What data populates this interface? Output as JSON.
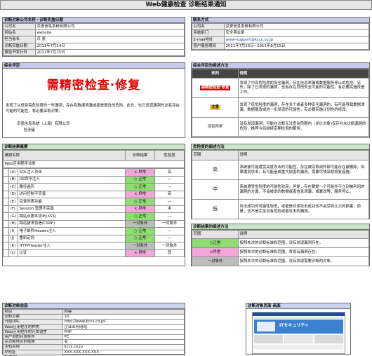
{
  "title": "Web健康检查 诊断结果通知",
  "target_info": {
    "header": "诊断对象公司名称・诊断实施日期",
    "rows": [
      {
        "label": "公司名",
        "value": "京瓷信息系统有限公司"
      },
      {
        "label": "网站名",
        "value": "website"
      },
      {
        "label": "担当者名",
        "value": "京 瓷"
      },
      {
        "label": "诊断实施日期",
        "value": "2011年7月14日"
      },
      {
        "label": "报告书发行日",
        "value": "2011年7月15日"
      }
    ]
  },
  "contact": {
    "header": "联系方式",
    "rows": [
      {
        "label": "公司名",
        "value": "京瓷信息系统有限公司"
      },
      {
        "label": "实施部门",
        "value": "安全事业部"
      },
      {
        "label": "E-mail地址",
        "value": "www-support@kccs.co.jp"
      },
      {
        "label": "客户服务期间",
        "value": "2011年7月15日~2011年8月15日"
      }
    ]
  },
  "overall": {
    "header": "综合评定",
    "verdict": "需精密检查·修复",
    "text": "发现了从低到高危险度的一些漏洞，存在有数据泄漏或者是篡改的危险。此外，也已发现漏洞外出有存在可能的可能性，将必要采取对策。",
    "company": "京瓷信息系统（上海）有限公司",
    "person": "检测者"
  },
  "evaluation": {
    "header": "综合评定的阐述方法",
    "col_eval": "评判",
    "col_desc": "说明",
    "rows": [
      {
        "eval": "需精密检查·修复",
        "desc": "发现了中高危险度的安全漏洞，存在信息泄漏或数据服务停止的危险。另外，除了已发现的漏洞，也有存在其他安全可能的可能性，有必要实施改造工作。"
      },
      {
        "eval": "注意",
        "desc": "发现了低危险度的漏洞，存在多个或者多种安全漏洞的，有可能导致数据泄漏、数据篡改或进一步发现的可能性，有必要实施计划性的修改。"
      },
      {
        "eval": "没有异常",
        "desc": "没有发现漏洞。可能在诊断无法查询范围内（评价对象)仅存在未诊断漏洞的危险，推荐今后继续定期检测的服务。"
      }
    ]
  },
  "results": {
    "header": "诊断结果概要",
    "col_item": "漏洞名称",
    "col_result": "诊断结果",
    "col_risk": "危险度",
    "group": "Web应用程序诊断",
    "items": [
      {
        "id": "(A)",
        "name": "SQL注入攻击",
        "result": "× 异常",
        "status": "ng",
        "risk": "高"
      },
      {
        "id": "(B)",
        "name": "OS命令注入",
        "result": "○ 正常",
        "status": "ok",
        "risk": "—"
      },
      {
        "id": "(C)",
        "name": "路径遍历",
        "result": "○ 正常",
        "status": "ok",
        "risk": "—"
      },
      {
        "id": "(D)",
        "name": "访问控制不完善",
        "result": "× 异常",
        "status": "ng",
        "risk": "高"
      },
      {
        "id": "(E)",
        "name": "目录列表功能",
        "result": "○ 正常",
        "status": "ok",
        "risk": "—"
      },
      {
        "id": "(F)",
        "name": "Session 管理不完善",
        "result": "× 异常",
        "status": "ng",
        "risk": "中"
      },
      {
        "id": "(G)",
        "name": "跨站点脚本攻击(XSS)",
        "result": "○ 正常",
        "status": "ok",
        "risk": "—"
      },
      {
        "id": "(H)",
        "name": "跨站请求伪造(CSRF)",
        "result": "一对象外",
        "status": "cond",
        "risk": "一对象外"
      },
      {
        "id": "(I)",
        "name": "电子邮件Header注入",
        "result": "○ 正常",
        "status": "ok",
        "risk": "—"
      },
      {
        "id": "(J)",
        "name": "重新定向",
        "result": "○ 正常",
        "status": "ok",
        "risk": "—"
      },
      {
        "id": "(K)",
        "name": "HTTPHeader注入",
        "result": "一对象外",
        "status": "cond",
        "risk": "一对象外"
      },
      {
        "id": "(L)",
        "name": "认证",
        "result": "× 异常",
        "status": "ng",
        "risk": "低"
      }
    ]
  },
  "risk_method": {
    "header": "危险度的阐述方法",
    "col_range": "范围",
    "col_desc": "说明",
    "rows": [
      {
        "level": "高",
        "desc": "系统被可能遭受高度攻击的可能性，存在被窃取或外部可能存在被删除，如果遭到攻击，有可能造成重大损害的漏洞，需要尽快采取修复措施。"
      },
      {
        "level": "中",
        "desc": "系统遭受危险度的可能性较高。但是，存在要提一个可能并不立刻被利用的漏洞的方面，不会被说的数据或者信息泄漏，或篡改等，服务停止。"
      },
      {
        "level": "低",
        "desc": "攻击成功的可能性较低，或者是对该攻击成功也不会受到太大的损害，但是，也不是完全没有危险或者攻击的漏洞。"
      }
    ]
  },
  "result_method": {
    "header": "诊断结果的阐述方法",
    "col_range": "范围",
    "col_desc": "说明",
    "rows": [
      {
        "label": "○正常",
        "status": "ok",
        "desc": "按照本次的诊断标准和范围，没有发现漏洞存在。"
      },
      {
        "label": "×异常",
        "status": "ng",
        "desc": "按照本次的诊断标准和范围，发现有漏洞存在。"
      },
      {
        "label": "一对象外",
        "status": "cond",
        "desc": "按照本次的诊断标准和范围，没有发现需要诊断的对象。"
      }
    ]
  },
  "target_detail": {
    "header": "诊断对象信息",
    "col_item": "项目",
    "col_content": "内容",
    "rows": [
      {
        "label": "诊断页数",
        "value": "10"
      },
      {
        "label": "开始URL",
        "value": "http://www.kccs.co.jp/"
      },
      {
        "label": "Web应用程序的种类",
        "value": "企业业务网站"
      },
      {
        "label": "Web应用程序的开发语言",
        "value": "PHP"
      },
      {
        "label": "用户测的环境条件",
        "value": "PC"
      },
      {
        "label": "从诊断地点的视角",
        "value": "有"
      },
      {
        "label": "主机名称",
        "value": "kccs.co.jp"
      },
      {
        "label": "IP地址",
        "value": "XXX.XXX.XXX.XXX"
      },
      {
        "label": "检测OS",
        "value": "—"
      }
    ]
  },
  "screenshot": {
    "header": "诊断对象页面 画面",
    "site_text": "ITセキュリティ"
  }
}
